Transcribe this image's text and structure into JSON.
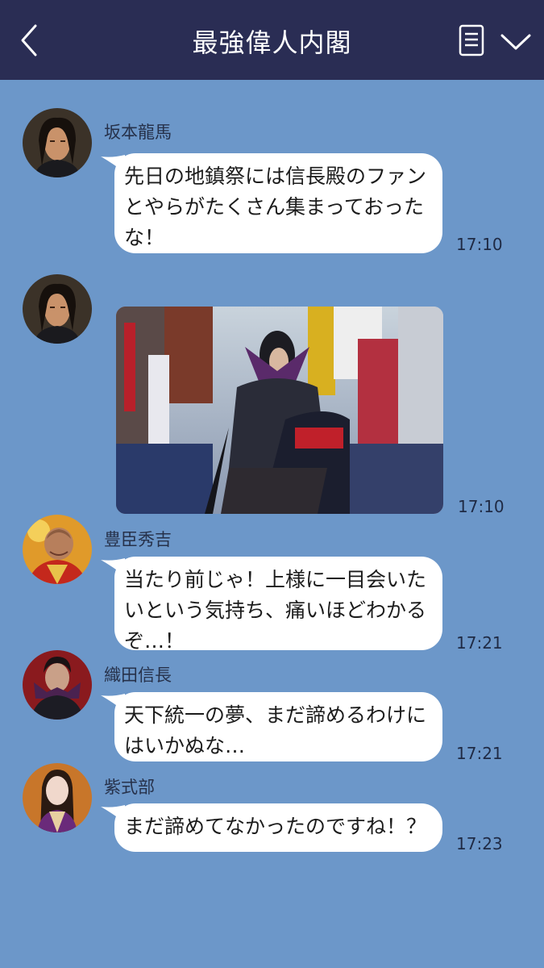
{
  "header": {
    "title": "最強偉人内閣",
    "back_icon": "chevron-left-icon",
    "menu_icon": "notes-icon",
    "expand_icon": "chevron-down-icon"
  },
  "colors": {
    "header_bg": "#2a2d54",
    "chat_bg": "#6c97c9",
    "bubble": "#ffffff"
  },
  "messages": [
    {
      "sender": "坂本龍馬",
      "text": "先日の地鎮祭には信長殿のファン\nとやらがたくさん集まっておった\nな！",
      "time": "17:10"
    },
    {
      "sender": "",
      "image": "photo of Oda Nobunaga on horseback in a festival procession",
      "time": "17:10"
    },
    {
      "sender": "豊臣秀吉",
      "text": "当たり前じゃ！上様に一目会いた\nいという気持ち、痛いほどわかる\nぞ…！",
      "time": "17:21"
    },
    {
      "sender": "織田信長",
      "text": "天下統一の夢、まだ諦めるわけに\nはいかぬな…",
      "time": "17:21"
    },
    {
      "sender": "紫式部",
      "text": "まだ諦めてなかったのですね！？",
      "time": "17:23"
    }
  ]
}
